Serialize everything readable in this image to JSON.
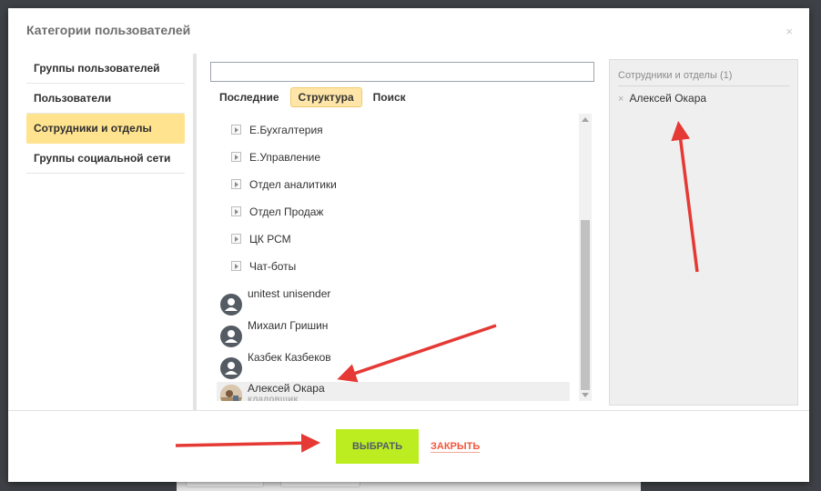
{
  "dialog": {
    "title": "Категории пользователей",
    "close_glyph": "×"
  },
  "sidebar": {
    "items": [
      {
        "label": "Группы пользователей",
        "active": false
      },
      {
        "label": "Пользователи",
        "active": false
      },
      {
        "label": "Сотрудники и отделы",
        "active": true
      },
      {
        "label": "Группы социальной сети",
        "active": false
      }
    ]
  },
  "search": {
    "value": "",
    "placeholder": ""
  },
  "tabs": [
    {
      "label": "Последние",
      "active": false
    },
    {
      "label": "Структура",
      "active": true
    },
    {
      "label": "Поиск",
      "active": false
    }
  ],
  "tree": {
    "folders": [
      {
        "label": "Е.Бухгалтерия"
      },
      {
        "label": "Е.Управление"
      },
      {
        "label": "Отдел аналитики"
      },
      {
        "label": "Отдел Продаж"
      },
      {
        "label": "ЦК РСМ"
      },
      {
        "label": "Чат-боты"
      }
    ],
    "users": [
      {
        "name": "unitest unisender",
        "role": "",
        "avatar": "default-avatar-icon",
        "selected": false
      },
      {
        "name": "Михаил Гришин",
        "role": "",
        "avatar": "default-avatar-icon",
        "selected": false
      },
      {
        "name": "Казбек Казбеков",
        "role": "",
        "avatar": "default-avatar-icon",
        "selected": false
      },
      {
        "name": "Алексей Окара",
        "role": "кладовщик",
        "avatar": "photo-avatar",
        "selected": true
      }
    ]
  },
  "selected": {
    "header": "Сотрудники и отделы (1)",
    "items": [
      {
        "name": "Алексей Окара",
        "remove_glyph": "×"
      }
    ]
  },
  "footer": {
    "select_label": "ВЫБРАТЬ",
    "close_label": "ЗАКРЫТЬ"
  },
  "colors": {
    "accent_yellow": "#ffe38f",
    "select_button": "#bbed21",
    "close_link": "#f2563d",
    "annotation_arrow": "#e53935"
  }
}
